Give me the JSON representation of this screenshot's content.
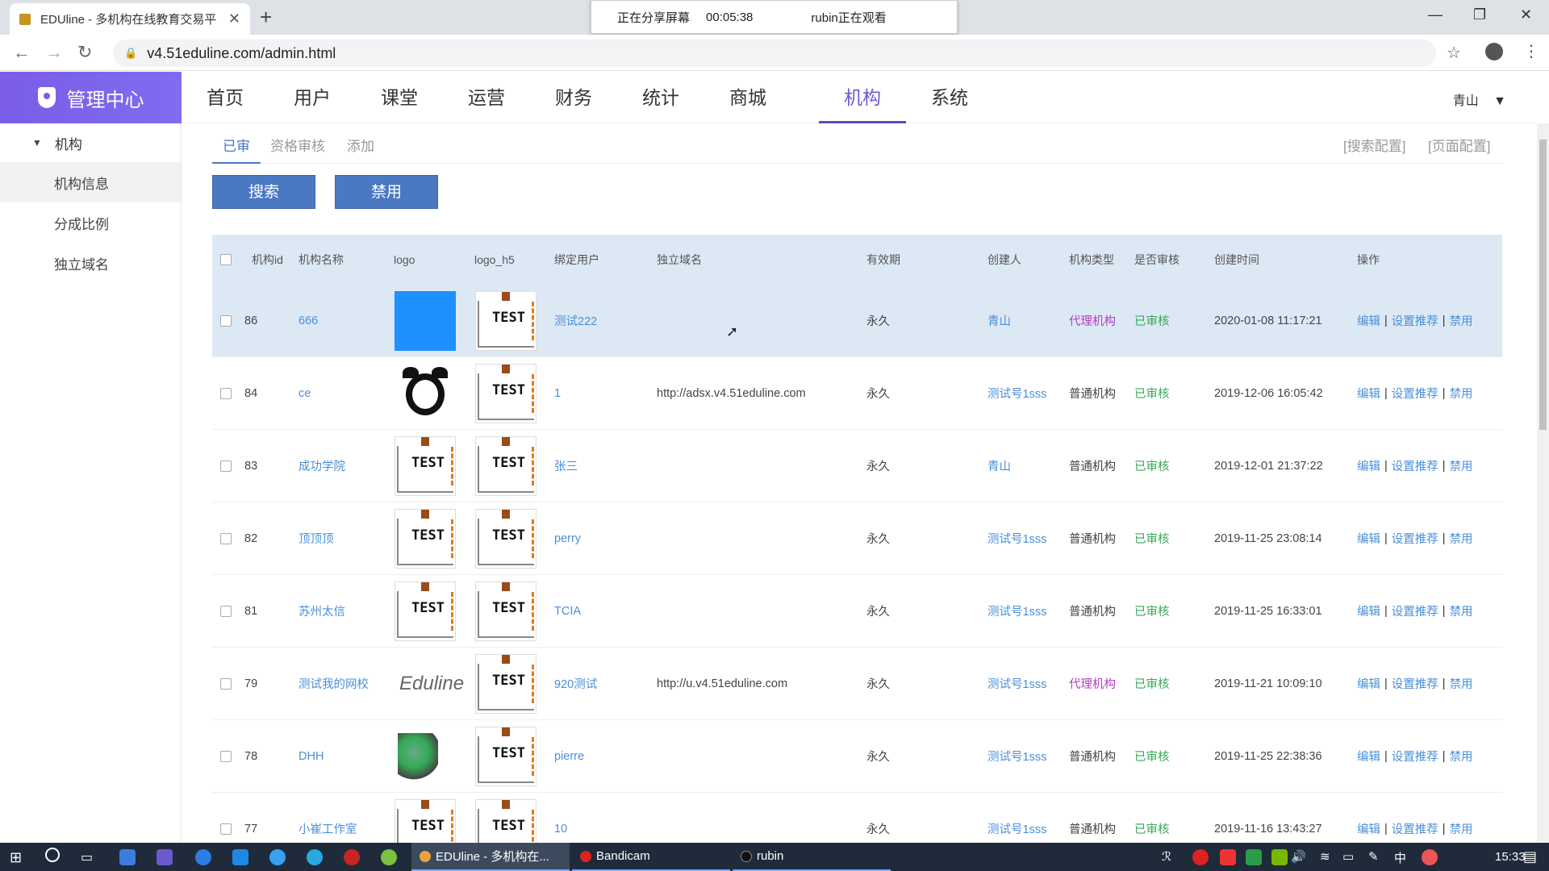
{
  "browser": {
    "tab_title": "EDUline - 多机构在线教育交易平",
    "tab_close": "✕",
    "new_tab": "+",
    "url": "v4.51eduline.com/admin.html"
  },
  "share_banner": {
    "status": "正在分享屏幕",
    "timer": "00:05:38",
    "watcher": "rubin正在观看"
  },
  "sidebar": {
    "header": "管理中心",
    "group": "机构",
    "items": [
      {
        "label": "机构信息",
        "active": true
      },
      {
        "label": "分成比例",
        "active": false
      },
      {
        "label": "独立域名",
        "active": false
      }
    ]
  },
  "topnav": {
    "items": [
      "首页",
      "用户",
      "课堂",
      "运营",
      "财务",
      "统计",
      "商城",
      "机构",
      "系统"
    ],
    "active": "机构",
    "user": "青山"
  },
  "subtabs": {
    "items": [
      "已审",
      "资格审核",
      "添加"
    ],
    "active": "已审",
    "search_config": "[搜索配置]",
    "page_config": "[页面配置]"
  },
  "buttons": {
    "search": "搜索",
    "disable": "禁用"
  },
  "table": {
    "headers": [
      "机构id",
      "机构名称",
      "logo",
      "logo_h5",
      "绑定用户",
      "独立域名",
      "有效期",
      "创建人",
      "机构类型",
      "是否审核",
      "创建时间",
      "操作"
    ],
    "ops": {
      "edit": "编辑",
      "recommend": "设置推荐",
      "disable": "禁用"
    },
    "rows": [
      {
        "id": "86",
        "name": "666",
        "logo": "blue",
        "user": "测试222",
        "domain": "",
        "validity": "永久",
        "creator": "青山",
        "type": "代理机构",
        "type_color": "purple",
        "audit": "已审核",
        "created": "2020-01-08 11:17:21"
      },
      {
        "id": "84",
        "name": "ce",
        "logo": "clock",
        "user": "1",
        "domain": "http://adsx.v4.51eduline.com",
        "validity": "永久",
        "creator": "测试号1sss",
        "type": "普通机构",
        "type_color": "plain",
        "audit": "已审核",
        "created": "2019-12-06 16:05:42"
      },
      {
        "id": "83",
        "name": "成功学院",
        "logo": "test",
        "user": "张三",
        "domain": "",
        "validity": "永久",
        "creator": "青山",
        "type": "普通机构",
        "type_color": "plain",
        "audit": "已审核",
        "created": "2019-12-01 21:37:22"
      },
      {
        "id": "82",
        "name": "顶顶顶",
        "logo": "test",
        "user": "perry",
        "domain": "",
        "validity": "永久",
        "creator": "测试号1sss",
        "type": "普通机构",
        "type_color": "plain",
        "audit": "已审核",
        "created": "2019-11-25 23:08:14"
      },
      {
        "id": "81",
        "name": "苏州太信",
        "logo": "test",
        "user": "TCIA",
        "domain": "",
        "validity": "永久",
        "creator": "测试号1sss",
        "type": "普通机构",
        "type_color": "plain",
        "audit": "已审核",
        "created": "2019-11-25 16:33:01"
      },
      {
        "id": "79",
        "name": "测试我的网校",
        "logo": "eduline",
        "user": "920测试",
        "domain": "http://u.v4.51eduline.com",
        "validity": "永久",
        "creator": "测试号1sss",
        "type": "代理机构",
        "type_color": "purple",
        "audit": "已审核",
        "created": "2019-11-21 10:09:10"
      },
      {
        "id": "78",
        "name": "DHH",
        "logo": "dhh",
        "user": "pierre",
        "domain": "",
        "validity": "永久",
        "creator": "测试号1sss",
        "type": "普通机构",
        "type_color": "plain",
        "audit": "已审核",
        "created": "2019-11-25 22:38:36"
      },
      {
        "id": "77",
        "name": "小崔工作室",
        "logo": "test",
        "user": "10",
        "domain": "",
        "validity": "永久",
        "creator": "测试号1sss",
        "type": "普通机构",
        "type_color": "plain",
        "audit": "已审核",
        "created": "2019-11-16 13:43:27"
      }
    ]
  },
  "logo_text": {
    "test": "TEST",
    "eduline": "Eduline"
  },
  "taskbar": {
    "apps": [
      {
        "label": "EDUline - 多机构在...",
        "active": true,
        "dot": "#e8a33a"
      },
      {
        "label": "Bandicam",
        "active": false,
        "dot": "#d22"
      },
      {
        "label": "rubin",
        "active": false,
        "dot": "#1a1a1a"
      }
    ],
    "ime": "中",
    "time": "15:33"
  },
  "colors": {
    "accent": "#7b5de6",
    "primary_button": "#4a78c2",
    "link": "#4a8fd8",
    "agent_type": "#b040c0",
    "approved": "#3aa85a"
  }
}
